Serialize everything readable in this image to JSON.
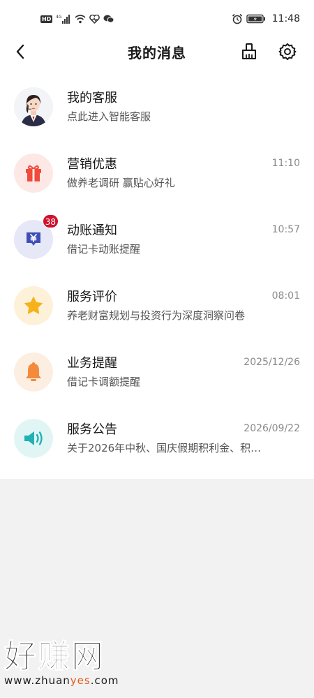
{
  "status_bar": {
    "hd": "HD",
    "network": "4G",
    "time": "11:48"
  },
  "header": {
    "title": "我的消息",
    "back_icon": "chevron-left-icon",
    "clean_icon": "broom-icon",
    "settings_icon": "gear-icon"
  },
  "messages": [
    {
      "title": "我的客服",
      "subtitle": "点此进入智能客服",
      "time": "",
      "icon": "customer-service-avatar"
    },
    {
      "title": "营销优惠",
      "subtitle": "做养老调研 赢贴心好礼",
      "time": "11:10",
      "icon": "gift-icon",
      "icon_color": "#f04a3a",
      "bg_color": "#fde8e6"
    },
    {
      "title": "动账通知",
      "subtitle": "借记卡动账提醒",
      "time": "10:57",
      "icon": "yuan-message-icon",
      "icon_color": "#3f4fb8",
      "bg_color": "#e6e8f7",
      "badge": "38"
    },
    {
      "title": "服务评价",
      "subtitle": "养老财富规划与投资行为深度洞察问卷",
      "time": "08:01",
      "icon": "star-icon",
      "icon_color": "#f5b21b",
      "bg_color": "#fdf1d9"
    },
    {
      "title": "业务提醒",
      "subtitle": "借记卡调额提醒",
      "time": "2025/12/26",
      "icon": "bell-icon",
      "icon_color": "#f38a3c",
      "bg_color": "#fdeee2"
    },
    {
      "title": "服务公告",
      "subtitle": "关于2026年中秋、国庆假期积利金、积…",
      "time": "2026/09/22",
      "icon": "speaker-icon",
      "icon_color": "#21b1b3",
      "bg_color": "#e1f5f5"
    }
  ],
  "watermark": {
    "big": "好赚网",
    "url_pre": "www.zhuan",
    "url_accent": "yes",
    "url_post": ".com"
  }
}
